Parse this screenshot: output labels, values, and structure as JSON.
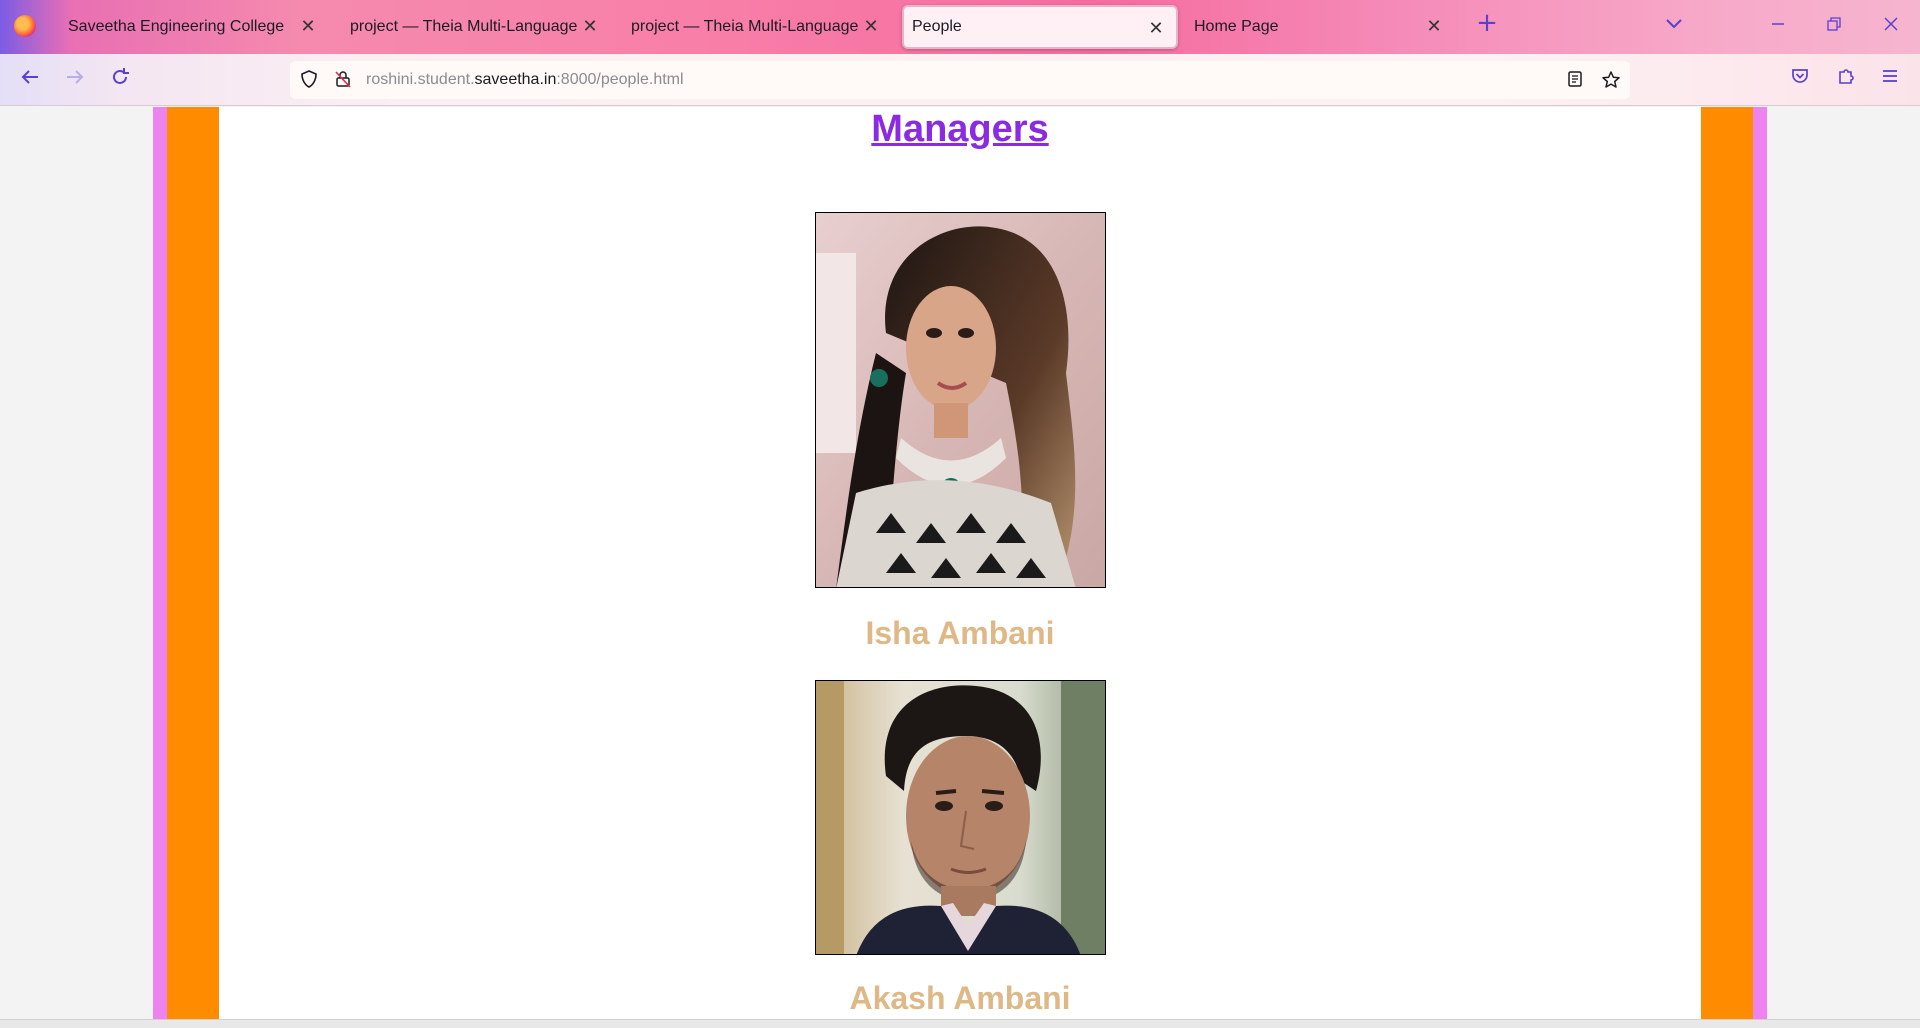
{
  "browser": {
    "tabs": [
      {
        "label": "Saveetha Engineering College",
        "active": false
      },
      {
        "label": "project — Theia Multi-Language Ex",
        "active": false
      },
      {
        "label": "project — Theia Multi-Language Ex",
        "active": false
      },
      {
        "label": "People",
        "active": true
      },
      {
        "label": "Home Page",
        "active": false
      }
    ],
    "url": {
      "prefix": "roshini.student.",
      "domain": "saveetha.in",
      "suffix": ":8000/people.html"
    }
  },
  "page": {
    "heading": "Managers",
    "people": [
      {
        "name": "Isha Ambani"
      },
      {
        "name": "Akash Ambani"
      }
    ],
    "colors": {
      "side_outer": "#ee82ee",
      "side_inner": "#ff8c00",
      "heading": "#8a2be2",
      "names": "#deb887"
    }
  }
}
